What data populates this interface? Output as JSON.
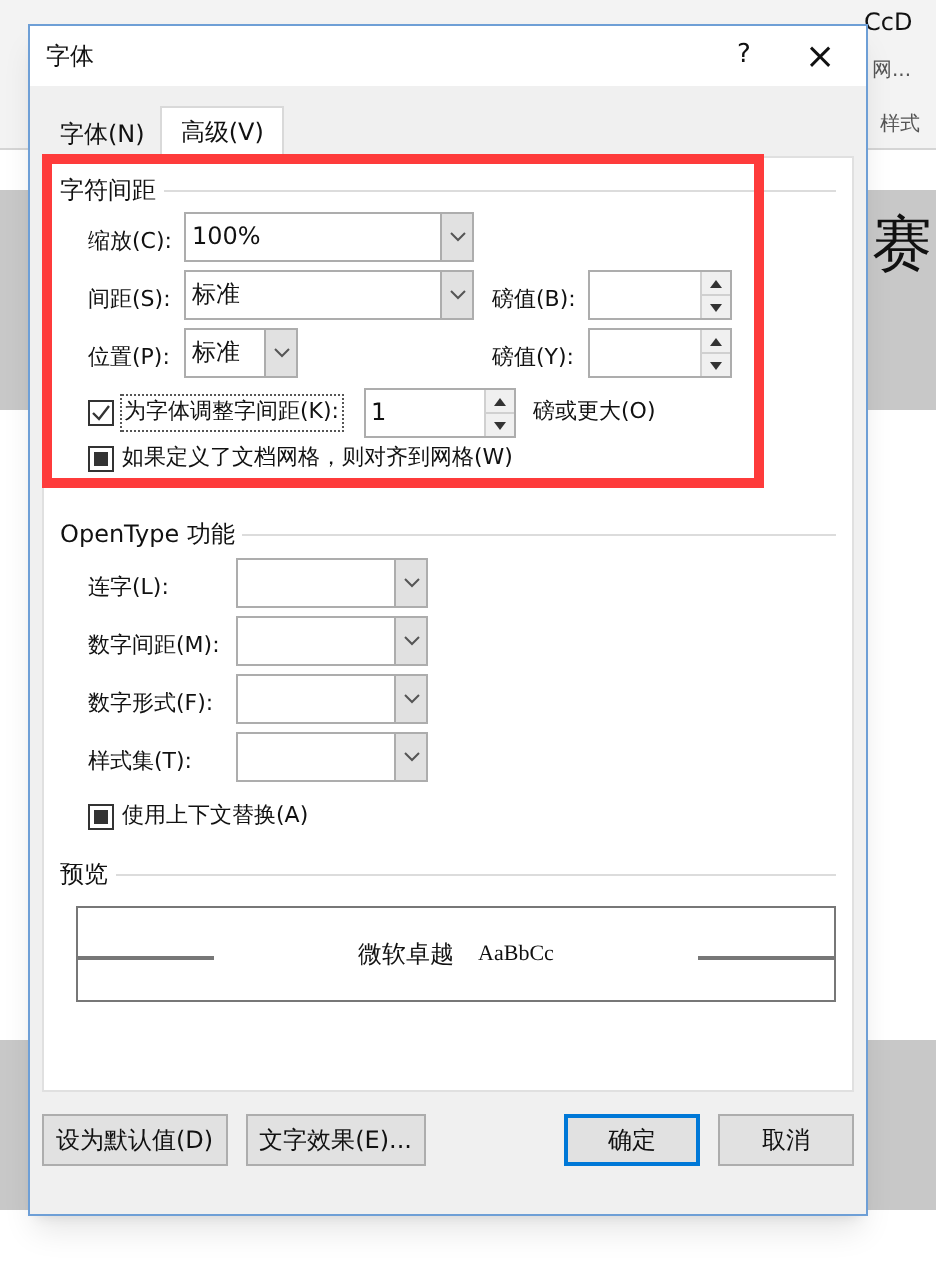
{
  "background": {
    "ribbon_samples": [
      "CcD"
    ],
    "ribbon_caption": "网...",
    "styles_label": "样式",
    "doc_glyph": "赛"
  },
  "window": {
    "title": "字体",
    "help": "?",
    "close": "×"
  },
  "tabs": [
    {
      "label": "字体(N)",
      "selected": false
    },
    {
      "label": "高级(V)",
      "selected": true
    }
  ],
  "spacing": {
    "title": "字符间距",
    "scale": {
      "label": "缩放(C):",
      "value": "100%"
    },
    "spacing": {
      "label": "间距(S):",
      "value": "标准",
      "points_label": "磅值(B):"
    },
    "position": {
      "label": "位置(P):",
      "value": "标准",
      "points_label": "磅值(Y):"
    },
    "kerning": {
      "label": "为字体调整字间距(K):",
      "checked": true,
      "value": "1",
      "suffix": "磅或更大(O)"
    },
    "grid": {
      "label": "如果定义了文档网格，则对齐到网格(W)",
      "indeterminate": true
    }
  },
  "opentype": {
    "title": "OpenType 功能",
    "fields": [
      {
        "label": "连字(L):"
      },
      {
        "label": "数字间距(M):"
      },
      {
        "label": "数字形式(F):"
      },
      {
        "label": "样式集(T):"
      }
    ],
    "contextual": {
      "label": "使用上下文替换(A)",
      "indeterminate": true
    }
  },
  "preview": {
    "title": "预览",
    "sample_cjk": "微软卓越",
    "sample_latin": "AaBbCc"
  },
  "buttons": [
    {
      "label": "设为默认值(D)",
      "primary": false
    },
    {
      "label": "文字效果(E)...",
      "primary": false
    },
    {
      "label": "确定",
      "primary": true
    },
    {
      "label": "取消",
      "primary": false
    }
  ],
  "annotation": {
    "kind": "highlight",
    "color": "#fe3b3b"
  }
}
